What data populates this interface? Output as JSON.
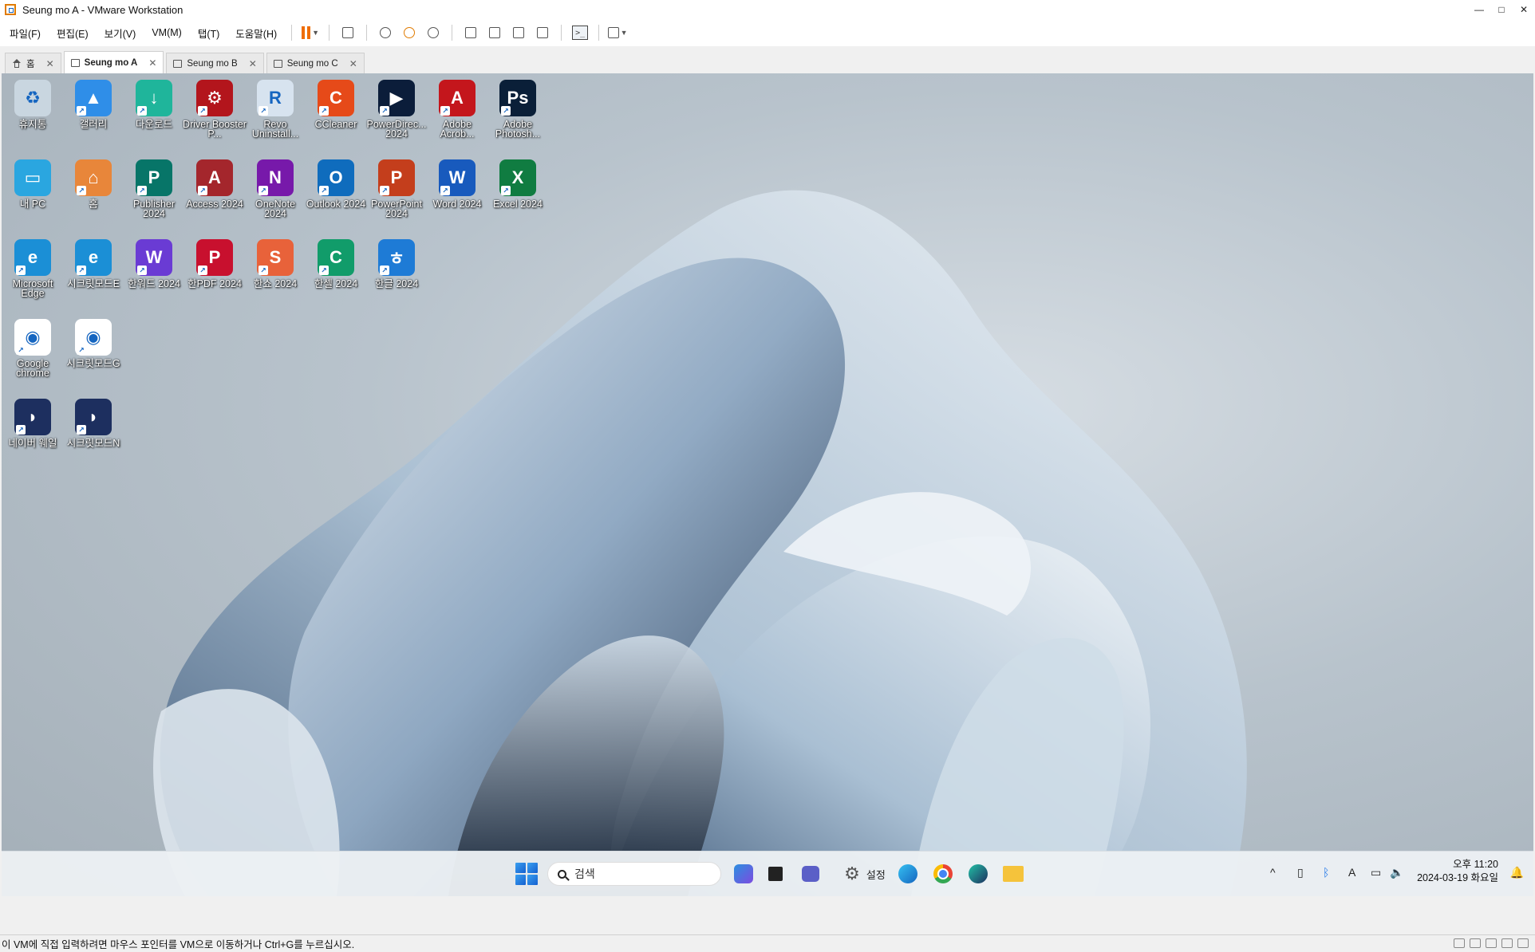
{
  "window": {
    "title": "Seung mo A - VMware Workstation",
    "minimize": "—",
    "maximize": "□",
    "close": "✕"
  },
  "menu": [
    "파일(F)",
    "편집(E)",
    "보기(V)",
    "VM(M)",
    "탭(T)",
    "도움말(H)"
  ],
  "tabs": [
    {
      "label": "홈"
    },
    {
      "label": "Seung mo A",
      "active": true
    },
    {
      "label": "Seung mo B"
    },
    {
      "label": "Seung mo C"
    }
  ],
  "tab_close": "✕",
  "desktop_icons": [
    {
      "label": "휴지통",
      "icon": "recycle-bin-icon",
      "color": "#c9d6e0",
      "glyph": "♻"
    },
    {
      "label": "갤러리",
      "icon": "gallery-icon",
      "color": "#2f8ee8",
      "glyph": "▲"
    },
    {
      "label": "다운로드",
      "icon": "downloads-folder-icon",
      "color": "#1fb59b",
      "glyph": "↓"
    },
    {
      "label": "Driver Booster P...",
      "icon": "driver-booster-icon",
      "color": "#b3151c",
      "glyph": "⚙"
    },
    {
      "label": "Revo Uninstall...",
      "icon": "revo-uninstaller-icon",
      "color": "#d7e3ef",
      "glyph": "R"
    },
    {
      "label": "CCleaner",
      "icon": "ccleaner-icon",
      "color": "#e64a19",
      "glyph": "C"
    },
    {
      "label": "PowerDirec... 2024",
      "icon": "powerdirector-icon",
      "color": "#0b1d3a",
      "glyph": "▶"
    },
    {
      "label": "Adobe Acrob...",
      "icon": "adobe-acrobat-icon",
      "color": "#c4161c",
      "glyph": "A"
    },
    {
      "label": "Adobe Photosh...",
      "icon": "photoshop-icon",
      "color": "#0a1f38",
      "glyph": "Ps"
    },
    {
      "label": "내 PC",
      "icon": "this-pc-icon",
      "color": "#2aa6e0",
      "glyph": "▭"
    },
    {
      "label": "홈",
      "icon": "home-icon",
      "color": "#e8863a",
      "glyph": "⌂"
    },
    {
      "label": "Publisher 2024",
      "icon": "publisher-icon",
      "color": "#077568",
      "glyph": "P"
    },
    {
      "label": "Access 2024",
      "icon": "access-icon",
      "color": "#a4262c",
      "glyph": "A"
    },
    {
      "label": "OneNote 2024",
      "icon": "onenote-icon",
      "color": "#7719aa",
      "glyph": "N"
    },
    {
      "label": "Outlook 2024",
      "icon": "outlook-icon",
      "color": "#0f6cbd",
      "glyph": "O"
    },
    {
      "label": "PowerPoint 2024",
      "icon": "powerpoint-icon",
      "color": "#c43e1c",
      "glyph": "P"
    },
    {
      "label": "Word 2024",
      "icon": "word-icon",
      "color": "#185abd",
      "glyph": "W"
    },
    {
      "label": "Excel 2024",
      "icon": "excel-icon",
      "color": "#107c41",
      "glyph": "X"
    },
    {
      "label": "Microsoft Edge",
      "icon": "edge-icon",
      "color": "#1b8fd6",
      "glyph": "e"
    },
    {
      "label": "시크릿모드E",
      "icon": "edge-secret-icon",
      "color": "#1b8fd6",
      "glyph": "e"
    },
    {
      "label": "한워드 2024",
      "icon": "hanword-icon",
      "color": "#6a3bd4",
      "glyph": "W"
    },
    {
      "label": "한PDF 2024",
      "icon": "hanpdf-icon",
      "color": "#c8102e",
      "glyph": "P"
    },
    {
      "label": "한쇼 2024",
      "icon": "hanshow-icon",
      "color": "#e8623a",
      "glyph": "S"
    },
    {
      "label": "한셀 2024",
      "icon": "hancell-icon",
      "color": "#119c6a",
      "glyph": "C"
    },
    {
      "label": "한글 2024",
      "icon": "hangul-icon",
      "color": "#1e7bd6",
      "glyph": "ㅎ"
    },
    {
      "label": "Google chrome",
      "icon": "chrome-icon",
      "color": "#ffffff",
      "glyph": "◉"
    },
    {
      "label": "시크릿모드G",
      "icon": "chrome-secret-icon",
      "color": "#ffffff",
      "glyph": "◉"
    },
    {
      "label": "네이버 웨일",
      "icon": "whale-icon",
      "color": "#1d2f5f",
      "glyph": "◗"
    },
    {
      "label": "시크릿모드N",
      "icon": "whale-secret-icon",
      "color": "#1d2f5f",
      "glyph": "◗"
    }
  ],
  "taskbar": {
    "search_placeholder": "검색",
    "settings_label": "설정",
    "tray_chevron": "^",
    "ime": "A",
    "time": "오후 11:20",
    "date": "2024-03-19 화요일"
  },
  "statusbar": {
    "message": "이 VM에 직접 입력하려면 마우스 포인터를 VM으로 이동하거나 Ctrl+G를 누르십시오."
  }
}
